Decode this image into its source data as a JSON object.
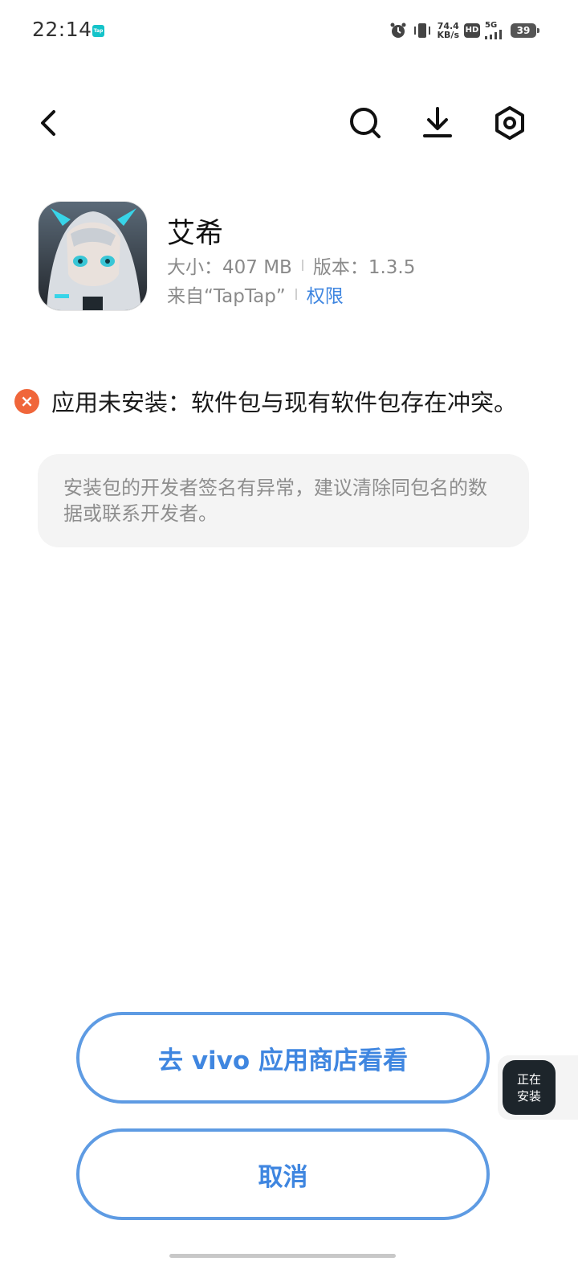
{
  "status_bar": {
    "time": "22:14",
    "tap_badge": "Tap",
    "net_speed_value": "74.4",
    "net_speed_unit": "KB/s",
    "hd_badge": "HD",
    "network_type": "5G",
    "battery": "39",
    "icons": [
      "alarm-icon",
      "vibrate-icon",
      "signal-icon",
      "battery-icon"
    ]
  },
  "nav": {
    "icons": [
      "back-icon",
      "search-icon",
      "download-icon",
      "settings-icon"
    ]
  },
  "app": {
    "name": "艾希",
    "size_label": "大小：407 MB",
    "version_label": "版本：1.3.5",
    "source_label": "来自“TapTap”",
    "permission_link": "权限"
  },
  "error": {
    "message": "应用未安装：软件包与现有软件包存在冲突。",
    "hint": "安装包的开发者签名有异常，建议清除同包名的数据或联系开发者。"
  },
  "buttons": {
    "store": "去 vivo 应用商店看看",
    "cancel": "取消"
  },
  "floating_widget": {
    "line1": "正在",
    "line2": "安装"
  },
  "colors": {
    "accent": "#3f86e0",
    "button_border": "#5e9be3",
    "error": "#f0663a",
    "hint_bg": "#f4f4f4"
  }
}
